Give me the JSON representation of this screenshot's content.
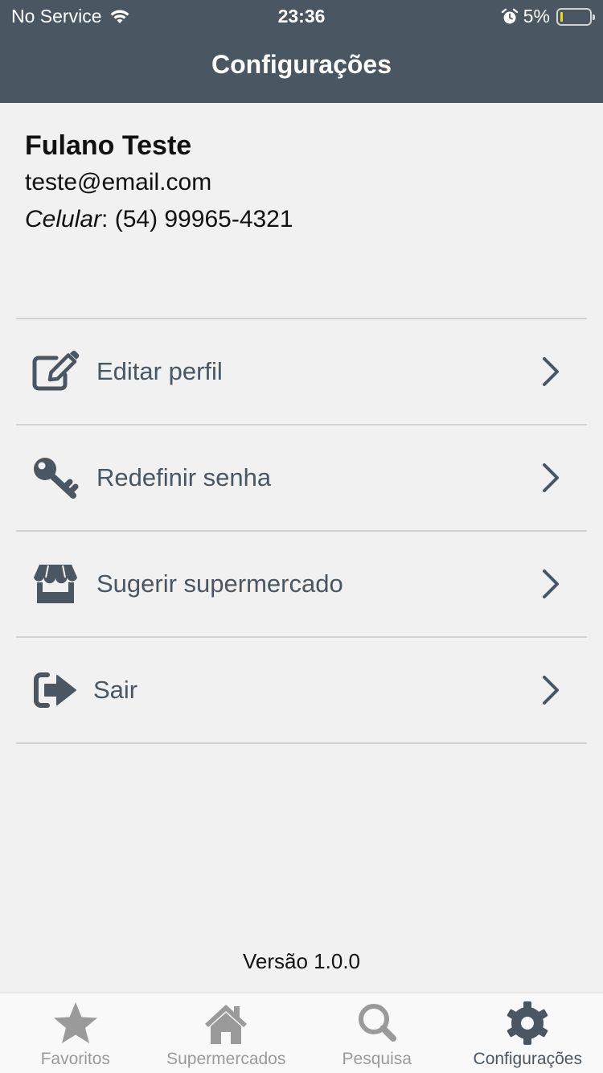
{
  "status_bar": {
    "carrier": "No Service",
    "time": "23:36",
    "battery_percent": "5%"
  },
  "header": {
    "title": "Configurações"
  },
  "profile": {
    "name": "Fulano Teste",
    "email": "teste@email.com",
    "phone_label": "Celular",
    "phone_number": "(54) 99965-4321"
  },
  "menu": {
    "items": [
      {
        "label": "Editar perfil",
        "icon": "edit-icon"
      },
      {
        "label": "Redefinir senha",
        "icon": "key-icon"
      },
      {
        "label": "Sugerir supermercado",
        "icon": "store-icon"
      },
      {
        "label": "Sair",
        "icon": "sign-out-icon"
      }
    ]
  },
  "footer": {
    "version": "Versão 1.0.0"
  },
  "tabs": [
    {
      "label": "Favoritos",
      "icon": "star-icon",
      "active": false
    },
    {
      "label": "Supermercados",
      "icon": "home-icon",
      "active": false
    },
    {
      "label": "Pesquisa",
      "icon": "search-icon",
      "active": false
    },
    {
      "label": "Configurações",
      "icon": "gear-icon",
      "active": true
    }
  ],
  "colors": {
    "header_bg": "#4a5661",
    "accent": "#4a5661",
    "background": "#f1f1f1",
    "inactive_tab": "#9a9a9a",
    "battery_level": "#f2d21b"
  }
}
